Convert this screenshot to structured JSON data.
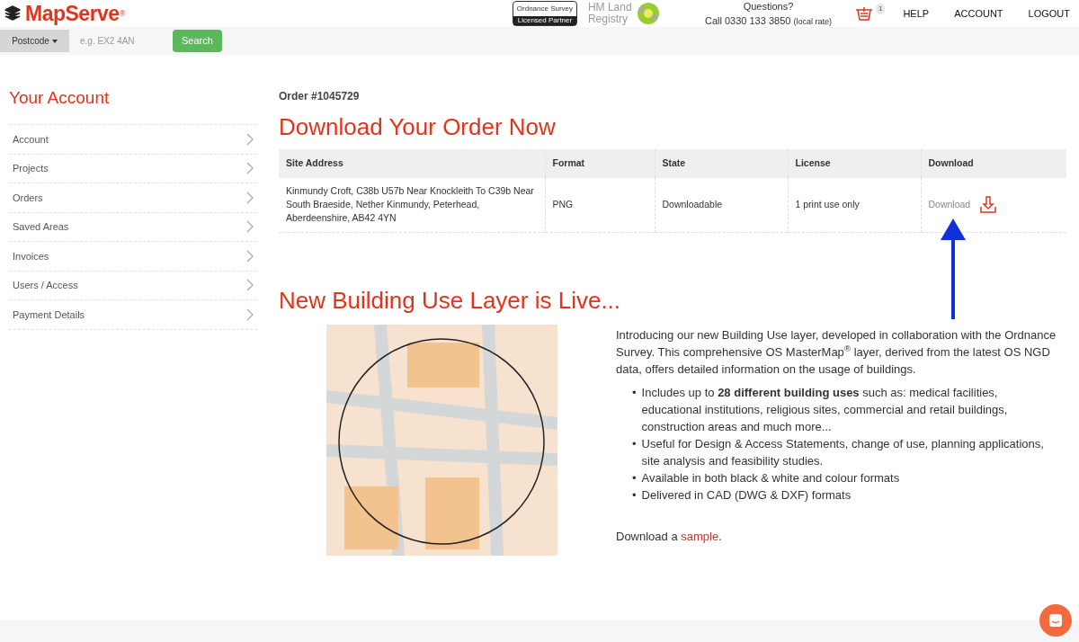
{
  "header": {
    "logo": "MapServe",
    "logo_mark": "®",
    "os_badge": {
      "name": "Ordnance Survey",
      "caption": "Licensed Partner"
    },
    "land_registry": "HM Land Registry",
    "questions": "Questions?",
    "phone": "Call 0330 133 3850",
    "phone_note": "(local rate)",
    "cart_count": "1",
    "nav": [
      "HELP",
      "ACCOUNT",
      "LOGOUT"
    ]
  },
  "search": {
    "dropdown": "Postcode",
    "placeholder": "e.g. EX2 4AN",
    "button": "Search"
  },
  "sidebar": {
    "title": "Your Account",
    "items": [
      {
        "label": "Account",
        "selected": false
      },
      {
        "label": "Projects",
        "selected": false
      },
      {
        "label": "Orders",
        "selected": false
      },
      {
        "label": "Saved Areas",
        "selected": false
      },
      {
        "label": "Invoices",
        "selected": false
      },
      {
        "label": "Users / Access",
        "selected": false
      },
      {
        "label": "Payment Details",
        "selected": false
      }
    ]
  },
  "order": {
    "number": "Order #1045729",
    "heading": "Download Your Order Now",
    "table": {
      "columns": [
        "Site Address",
        "Format",
        "State",
        "License",
        "Download"
      ],
      "rows": [
        {
          "address": "Kinmundy Croft, C38b U57b Near Knockleith To C39b Near South Braeside, Nether Kinmundy, Peterhead, Aberdeenshire, AB42 4YN",
          "format": "PNG",
          "state": "Downloadable",
          "license": "1 print use only",
          "download": "Download"
        }
      ]
    }
  },
  "promo": {
    "heading": "New Building Use Layer is Live...",
    "intro": "Introducing our new Building Use layer, developed in collaboration with the Ordnance Survey. This comprehensive OS MasterMap$^{®}$ layer, derived from the latest OS NGD data, offers detailed information on the usage of buildings.",
    "bullet_marker": "•",
    "bullets": [
      "Includes up to **28 different building uses** such as: medical facilities, educational institutions, religious sites, commercial and retail buildings, construction areas and much more...",
      "Useful for Design & Access Statements, change of use, planning applications, site analysis and feasibility studies.",
      "Available in both black & white and colour formats",
      "Delivered in CAD (DWG & DXF) formats"
    ],
    "sample_prefix": "Download a",
    "sample_link": "sample",
    "sample_suffix": "."
  }
}
